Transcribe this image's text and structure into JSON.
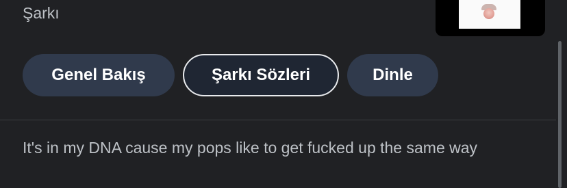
{
  "header": {
    "subtitle": "Şarkı"
  },
  "tabs": [
    {
      "label": "Genel Bakış",
      "selected": false
    },
    {
      "label": "Şarkı Sözleri",
      "selected": true
    },
    {
      "label": "Dinle",
      "selected": false
    }
  ],
  "lyrics": {
    "text": "It's in my DNA cause my pops like to get fucked up the same way"
  },
  "colors": {
    "background": "#202124",
    "chip": "#303a4c",
    "chip_selected_border": "#e8eaed",
    "text_secondary": "#bdc1c6"
  }
}
